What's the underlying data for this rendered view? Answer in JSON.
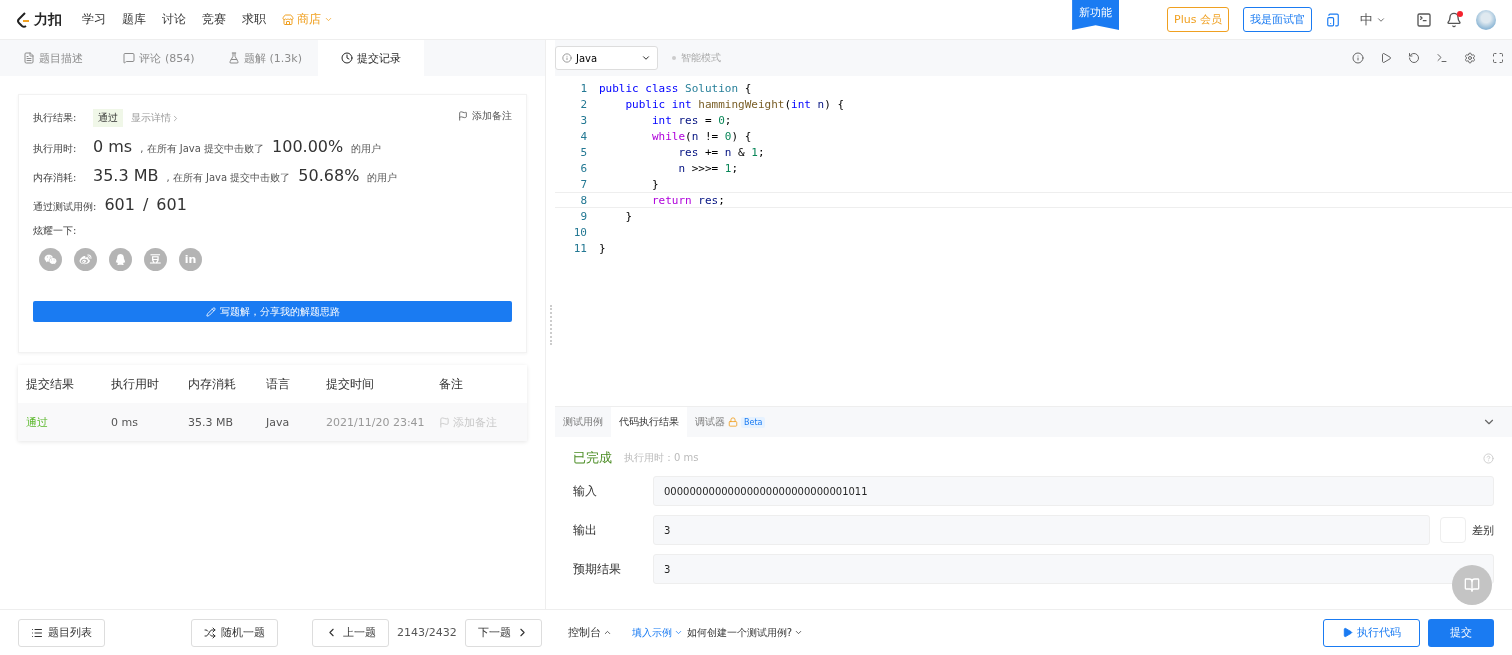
{
  "nav": {
    "logo": "力扣",
    "links": [
      "学习",
      "题库",
      "讨论",
      "竞赛",
      "求职"
    ],
    "store": "商店",
    "new_feature": "新功能",
    "plus": "Plus 会员",
    "interviewer": "我是面试官",
    "language": "中",
    "notification_dot": true
  },
  "left_tabs": [
    {
      "label": "题目描述",
      "selected": false
    },
    {
      "label": "评论 (854)",
      "selected": false
    },
    {
      "label": "题解 (1.3k)",
      "selected": false
    },
    {
      "label": "提交记录",
      "selected": true
    }
  ],
  "result": {
    "result_label": "执行结果:",
    "status": "通过",
    "details": "显示详情",
    "add_note": "添加备注",
    "time_label": "执行用时:",
    "time_value": "0 ms",
    "time_text": ", 在所有 Java 提交中击败了",
    "time_percent": "100.00%",
    "time_suffix": "的用户",
    "memory_label": "内存消耗:",
    "memory_value": "35.3 MB",
    "memory_text": ", 在所有 Java 提交中击败了",
    "memory_percent": "50.68%",
    "memory_suffix": "的用户",
    "cases_label": "通过测试用例:",
    "cases_passed": "601",
    "cases_sep": "/",
    "cases_total": "601",
    "share_label": "炫耀一下:",
    "share": [
      {
        "kind": "wechat"
      },
      {
        "kind": "weibo"
      },
      {
        "kind": "qq"
      },
      {
        "kind": "douban",
        "label": "豆"
      },
      {
        "kind": "linkedin",
        "label": "in"
      }
    ],
    "write_button": "写题解，分享我的解题思路"
  },
  "submissions": {
    "columns": [
      "提交结果",
      "执行用时",
      "内存消耗",
      "语言",
      "提交时间",
      "备注"
    ],
    "rows": [
      {
        "status": "通过",
        "time": "0 ms",
        "memory": "35.3 MB",
        "language": "Java",
        "submitted": "2021/11/20 23:41",
        "note": "添加备注"
      }
    ]
  },
  "editor": {
    "language": "Java",
    "smart_mode": "智能模式",
    "lines": [
      {
        "number": "1",
        "current": false,
        "tokens": [
          {
            "text": "public class ",
            "kind": "keyword"
          },
          {
            "text": "Solution",
            "kind": "type"
          },
          {
            "text": " {",
            "kind": "plain"
          }
        ]
      },
      {
        "number": "2",
        "current": false,
        "tokens": [
          {
            "text": "    public int ",
            "kind": "keyword"
          },
          {
            "text": "hammingWeight",
            "kind": "function"
          },
          {
            "text": "(",
            "kind": "plain"
          },
          {
            "text": "int ",
            "kind": "keyword"
          },
          {
            "text": "n",
            "kind": "variable"
          },
          {
            "text": ") {",
            "kind": "plain"
          }
        ]
      },
      {
        "number": "3",
        "current": false,
        "tokens": [
          {
            "text": "        int ",
            "kind": "keyword"
          },
          {
            "text": "res",
            "kind": "variable"
          },
          {
            "text": " = ",
            "kind": "plain"
          },
          {
            "text": "0",
            "kind": "number"
          },
          {
            "text": ";",
            "kind": "plain"
          }
        ]
      },
      {
        "number": "4",
        "current": false,
        "tokens": [
          {
            "text": "        while",
            "kind": "control"
          },
          {
            "text": "(",
            "kind": "plain"
          },
          {
            "text": "n",
            "kind": "variable"
          },
          {
            "text": " != ",
            "kind": "plain"
          },
          {
            "text": "0",
            "kind": "number"
          },
          {
            "text": ") {",
            "kind": "plain"
          }
        ]
      },
      {
        "number": "5",
        "current": false,
        "tokens": [
          {
            "text": "            res",
            "kind": "variable"
          },
          {
            "text": " += ",
            "kind": "plain"
          },
          {
            "text": "n",
            "kind": "variable"
          },
          {
            "text": " & ",
            "kind": "plain"
          },
          {
            "text": "1",
            "kind": "number"
          },
          {
            "text": ";",
            "kind": "plain"
          }
        ]
      },
      {
        "number": "6",
        "current": false,
        "tokens": [
          {
            "text": "            n",
            "kind": "variable"
          },
          {
            "text": " >>>= ",
            "kind": "plain"
          },
          {
            "text": "1",
            "kind": "number"
          },
          {
            "text": ";",
            "kind": "plain"
          }
        ]
      },
      {
        "number": "7",
        "current": false,
        "tokens": [
          {
            "text": "        }",
            "kind": "plain"
          }
        ]
      },
      {
        "number": "8",
        "current": true,
        "tokens": [
          {
            "text": "        return ",
            "kind": "control"
          },
          {
            "text": "res",
            "kind": "variable"
          },
          {
            "text": ";",
            "kind": "plain"
          }
        ]
      },
      {
        "number": "9",
        "current": false,
        "tokens": [
          {
            "text": "    }",
            "kind": "plain"
          }
        ]
      },
      {
        "number": "10",
        "current": false
      },
      {
        "number": "11",
        "current": false,
        "tokens": [
          {
            "text": "}",
            "kind": "plain"
          }
        ]
      }
    ]
  },
  "console": {
    "tabs": [
      {
        "label": "测试用例",
        "selected": false
      },
      {
        "label": "代码执行结果",
        "selected": true
      },
      {
        "label": "调试器",
        "selected": false,
        "locked": true,
        "badge": "Beta"
      }
    ],
    "status": "已完成",
    "runtime": "执行用时：0 ms",
    "fields": [
      {
        "label": "输入",
        "value": "00000000000000000000000000001011"
      },
      {
        "label": "输出",
        "value": "3",
        "diff": {
          "label": "差别",
          "checked": false
        }
      },
      {
        "label": "预期结果",
        "value": "3"
      }
    ]
  },
  "footer": {
    "problem_list": "题目列表",
    "random": "随机一题",
    "prev": "上一题",
    "position": "2143/2432",
    "next": "下一题",
    "console": "控制台",
    "fill_example": "填入示例",
    "how_to": "如何创建一个测试用例?",
    "run": "执行代码",
    "submit": "提交"
  }
}
